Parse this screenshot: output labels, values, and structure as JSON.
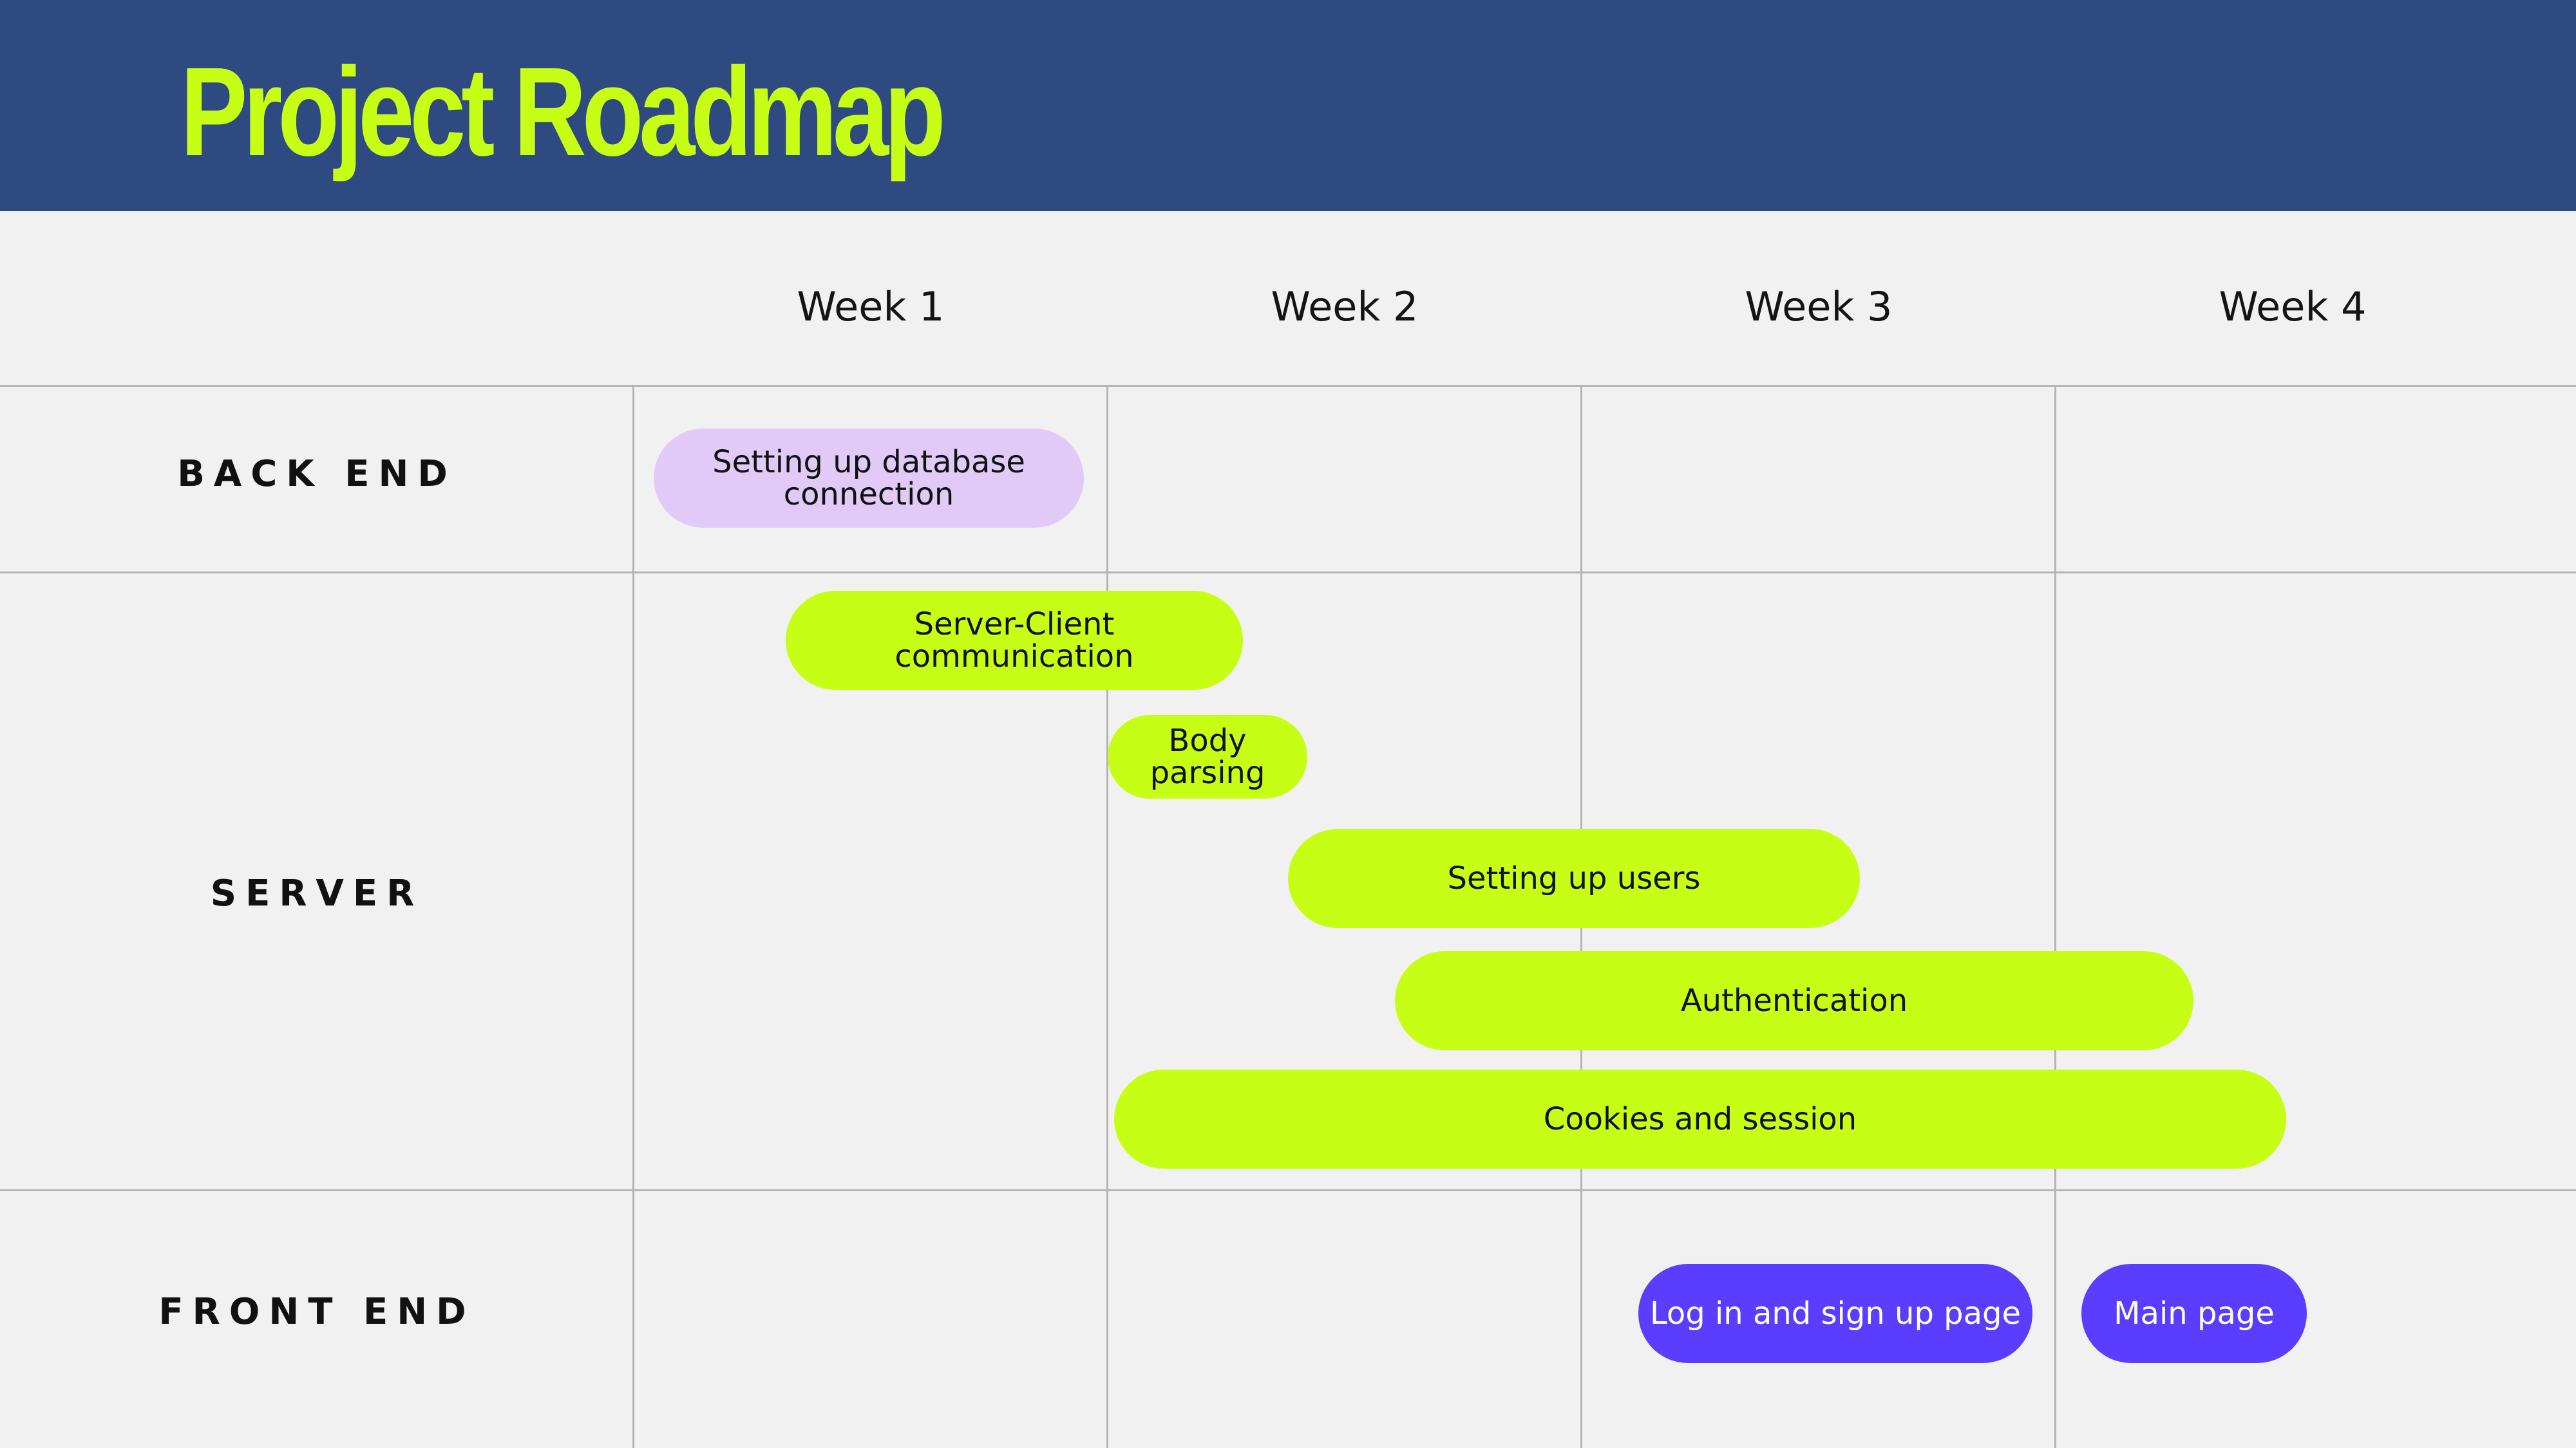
{
  "title": "Project Roadmap",
  "weeks": [
    "Week 1",
    "Week 2",
    "Week 3",
    "Week 4"
  ],
  "categories": {
    "back_end": "BACK END",
    "server": "SERVER",
    "front_end": "FRONT END"
  },
  "tasks": {
    "db_connection": "Setting up database\nconnection",
    "server_client": "Server-Client\ncommunication",
    "body_parsing": "Body\nparsing",
    "setting_up_users": "Setting up users",
    "authentication": "Authentication",
    "cookies_session": "Cookies and session",
    "login_signup": "Log in and sign up page",
    "main_page": "Main page"
  },
  "colors": {
    "header": "#2e4a80",
    "title": "#c6ff15",
    "back_end_task": "#e2caf8",
    "server_task": "#c6ff15",
    "front_end_task": "#5a3dff"
  }
}
